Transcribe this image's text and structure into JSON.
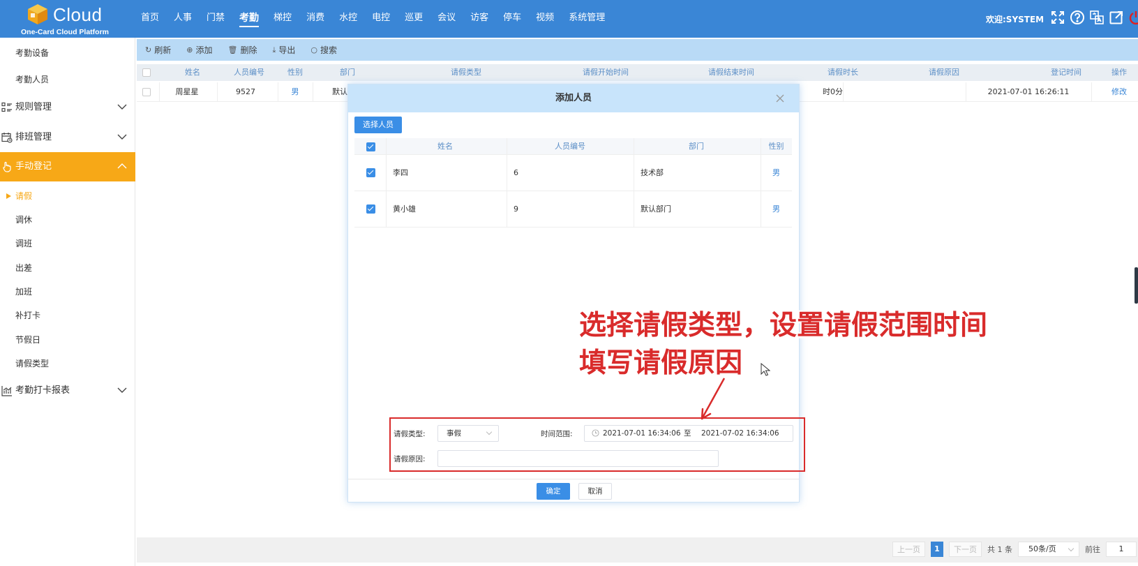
{
  "header": {
    "logo_word": "Cloud",
    "logo_sub": "One-Card Cloud Platform",
    "nav": [
      "首页",
      "人事",
      "门禁",
      "考勤",
      "梯控",
      "消费",
      "水控",
      "电控",
      "巡更",
      "会议",
      "访客",
      "停车",
      "视频",
      "系统管理"
    ],
    "active_nav": "考勤",
    "welcome": "欢迎:SYSTEM",
    "icons": [
      "fullscreen-icon",
      "help-icon",
      "translate-icon",
      "external-link-icon",
      "power-icon"
    ]
  },
  "sidebar": {
    "top_items": [
      "考勤设备",
      "考勤人员"
    ],
    "groups": [
      {
        "label": "规则管理",
        "icon": "rules-icon"
      },
      {
        "label": "排班管理",
        "icon": "calendar-icon"
      },
      {
        "label": "手动登记",
        "icon": "hand-icon"
      }
    ],
    "sub_items": [
      "请假",
      "调休",
      "调班",
      "出差",
      "加班",
      "补打卡",
      "节假日",
      "请假类型"
    ],
    "active_sub": "请假",
    "bottom_group": {
      "label": "考勤打卡报表",
      "icon": "chart-icon"
    },
    "accent_color": "#f7a817"
  },
  "toolbar": {
    "refresh": "刷新",
    "add": "添加",
    "delete": "删除",
    "export": "导出",
    "search": "搜索"
  },
  "table": {
    "columns": [
      "姓名",
      "人员编号",
      "性别",
      "部门",
      "请假类型",
      "请假开始时间",
      "请假结束时间",
      "请假时长",
      "请假原因",
      "登记时间",
      "操作"
    ],
    "rows": [
      {
        "name": "周星星",
        "id": "9527",
        "gender": "男",
        "dept": "默认",
        "duration": "时0分",
        "register_time": "2021-07-01 16:26:11",
        "action": "修改"
      }
    ]
  },
  "pager": {
    "prev": "上一页",
    "page": "1",
    "next": "下一页",
    "total": "共 1 条",
    "page_size": "50条/页",
    "goto_label": "前往",
    "goto_value": "1"
  },
  "modal": {
    "title": "添加人员",
    "select_button": "选择人员",
    "columns": [
      "姓名",
      "人员编号",
      "部门",
      "性别"
    ],
    "rows": [
      {
        "name": "李四",
        "id": "6",
        "dept": "技术部",
        "gender": "男"
      },
      {
        "name": "黄小雄",
        "id": "9",
        "dept": "默认部门",
        "gender": "男"
      }
    ],
    "form": {
      "type_label": "请假类型:",
      "type_value": "事假",
      "range_label": "时间范围:",
      "range_start": "2021-07-01 16:34:06",
      "range_sep": "至",
      "range_end": "2021-07-02 16:34:06",
      "reason_label": "请假原因:",
      "reason_value": ""
    },
    "ok": "确定",
    "cancel": "取消"
  },
  "annotation": {
    "line1": "选择请假类型，设置请假范围时间",
    "line2": "填写请假原因",
    "color": "#d92b2b"
  }
}
